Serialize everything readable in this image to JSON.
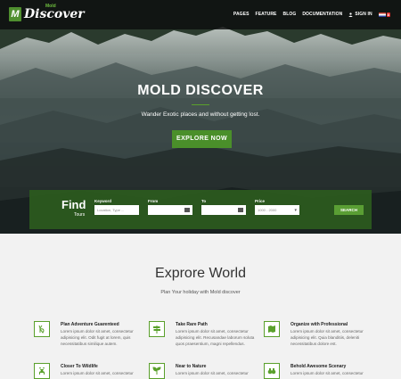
{
  "brand": {
    "mark": "M",
    "name": "Discover",
    "sup": "Mold"
  },
  "nav": {
    "items": [
      "PAGES",
      "FEATURE",
      "BLOG",
      "DOCUMENTATION"
    ],
    "signin": "SIGN IN",
    "flag_badge": "8"
  },
  "hero": {
    "title": "MOLD DISCOVER",
    "subtitle": "Wander Exotic places and without getting lost.",
    "cta": "EXPLORE NOW"
  },
  "search": {
    "find": "Find",
    "find_sub": "Tours",
    "keyword_label": "Keyword",
    "keyword_placeholder": "Location, Type ...",
    "from_label": "From",
    "to_label": "To",
    "price_label": "Price",
    "price_value": "1000 - 2000",
    "button": "SEARCH"
  },
  "world": {
    "title": "Exprore World",
    "subtitle": "Plan Your holiday with Mold discover",
    "features": [
      {
        "title": "Plan Adventure Guarenteed",
        "text": "Lorem ipsum dolor sit amet, consectetur adipisicing elit. Odit fugit at lorem, quis necessitatibus similique autem.",
        "icon": "peace-hand-icon"
      },
      {
        "title": "Take Rare Path",
        "text": "Lorem ipsum dolor sit amet, consectetur adipisicing elit. Recusandae laborum soluta quos praesentium, magni repellendus.",
        "icon": "signpost-icon"
      },
      {
        "title": "Organize with Professional",
        "text": "Lorem ipsum dolor sit amet, consectetur adipisicing elit. Quia blanditiis, deleniti necessitatibus dolore est.",
        "icon": "map-icon"
      },
      {
        "title": "Closer To Wildlife",
        "text": "Lorem ipsum dolor sit amet, consectetur",
        "icon": "deer-icon"
      },
      {
        "title": "Near to Nature",
        "text": "Lorem ipsum dolor sit amet, consectetur",
        "icon": "plant-icon"
      },
      {
        "title": "Behold Awesome Scenary",
        "text": "Lorem ipsum dolor sit amet, consectetur",
        "icon": "binoculars-icon"
      }
    ]
  },
  "colors": {
    "accent": "#4a8f2a",
    "search_bg": "#2c5c1e",
    "nav_bg": "#0c0e0e"
  }
}
